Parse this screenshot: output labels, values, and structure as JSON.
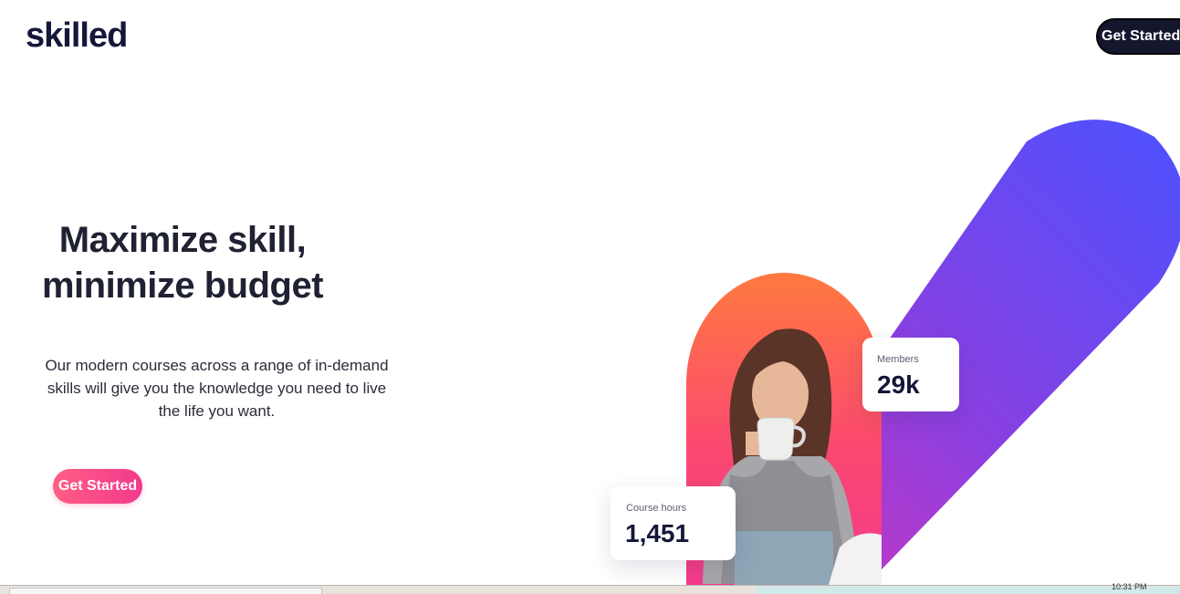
{
  "brand": {
    "logo": "skilled"
  },
  "nav": {
    "cta_label": "Get Started"
  },
  "hero": {
    "title_line1": "Maximize skill,",
    "title_line2": "minimize budget",
    "description": "Our modern courses across a range of in-demand skills will give you the knowledge you need to live the life you want.",
    "cta_label": "Get Started"
  },
  "stats": {
    "members": {
      "label": "Members",
      "value": "29k"
    },
    "course_hours": {
      "label": "Course hours",
      "value": "1,451"
    }
  },
  "taskbar": {
    "clock": "10:31 PM"
  },
  "colors": {
    "navy": "#15173a",
    "pink_start": "#ff5e84",
    "pink_end": "#f2398c",
    "blue_band": "#4f52ff",
    "purple_band": "#b738cf",
    "orange_pill": "#ff7a45"
  },
  "icons": [
    "woman-with-mug-photo"
  ]
}
